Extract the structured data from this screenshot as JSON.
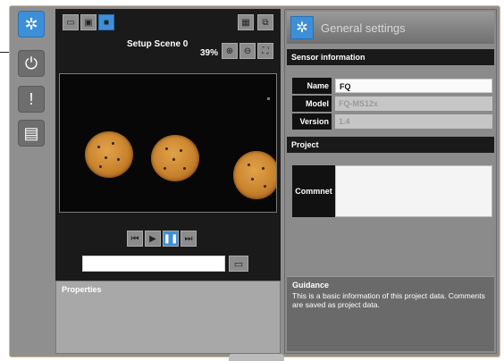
{
  "left_toolbar": {
    "buttons": [
      {
        "icon": "gear-icon",
        "glyph": "✲",
        "active": true
      },
      {
        "icon": "power-icon",
        "glyph": "⏻",
        "active": false
      },
      {
        "icon": "alert-icon",
        "glyph": "!",
        "active": false
      },
      {
        "icon": "toolbox-icon",
        "glyph": "▤",
        "active": false
      }
    ]
  },
  "camera": {
    "scene_label": "Setup Scene 0",
    "zoom_level": "39%",
    "file_path_value": ""
  },
  "properties": {
    "label": "Properties"
  },
  "general_settings": {
    "title": "General settings",
    "sensor_section": "Sensor information",
    "name_label": "Name",
    "name_value": "FQ",
    "model_label": "Model",
    "model_value": "FQ-MS12x",
    "version_label": "Version",
    "version_value": "1.4",
    "project_section": "Project",
    "comment_label": "Commnet",
    "comment_value": ""
  },
  "guidance": {
    "title": "Guidance",
    "text": "This is a basic information of this project data. Comments are saved as project data."
  },
  "colors": {
    "accent": "#3d8fd8",
    "panel": "#8b8b8b",
    "dark": "#1a1a1a"
  }
}
